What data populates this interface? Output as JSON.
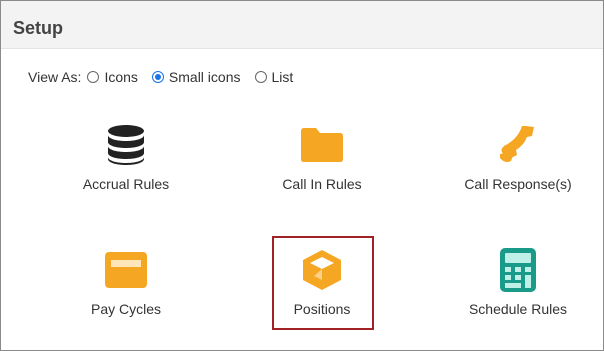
{
  "header": {
    "title": "Setup"
  },
  "view_as": {
    "label": "View As:",
    "options": [
      "Icons",
      "Small icons",
      "List"
    ],
    "selected": "Small icons"
  },
  "items": [
    {
      "label": "Accrual Rules",
      "icon": "database-icon",
      "color": "#222222"
    },
    {
      "label": "Call In Rules",
      "icon": "folder-icon",
      "color": "#f5a623"
    },
    {
      "label": "Call Response(s)",
      "icon": "phone-icon",
      "color": "#f5a623"
    },
    {
      "label": "Pay Cycles",
      "icon": "credit-card-icon",
      "color": "#f5a623"
    },
    {
      "label": "Positions",
      "icon": "cube-icon",
      "color": "#f5a623",
      "selected": true
    },
    {
      "label": "Schedule Rules",
      "icon": "calculator-icon",
      "color": "#1a9b8a"
    }
  ]
}
